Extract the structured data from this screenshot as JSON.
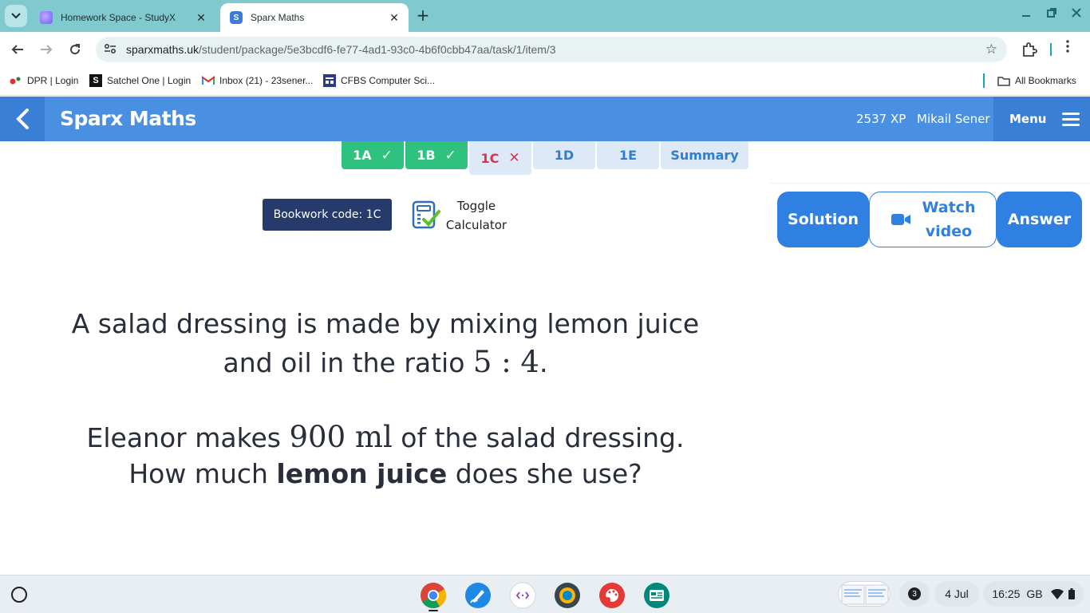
{
  "browser": {
    "tabs": [
      {
        "title": "Homework Space - StudyX",
        "close": "✕"
      },
      {
        "title": "Sparx Maths",
        "favicon_letter": "S",
        "close": "✕"
      }
    ],
    "new_tab": "+",
    "url_host": "sparxmaths.uk",
    "url_path": "/student/package/5e3bcdf6-fe77-4ad1-93c0-4b6f0cbb47aa/task/1/item/3",
    "bookmarks": [
      {
        "label": "DPR | Login"
      },
      {
        "label": "Satchel One | Login",
        "icon_letter": "S"
      },
      {
        "label": "Inbox (21) - 23sener..."
      },
      {
        "label": "CFBS Computer Sci..."
      }
    ],
    "all_bookmarks": "All Bookmarks"
  },
  "header": {
    "brand": "Sparx Maths",
    "xp": "2537 XP",
    "user": "Mikail Sener",
    "menu": "Menu"
  },
  "task_tabs": [
    {
      "label": "1A",
      "status": "correct",
      "mark": "✓"
    },
    {
      "label": "1B",
      "status": "correct",
      "mark": "✓"
    },
    {
      "label": "1C",
      "status": "incorrect",
      "mark": "✕"
    },
    {
      "label": "1D",
      "status": "pending"
    },
    {
      "label": "1E",
      "status": "pending"
    },
    {
      "label": "Summary",
      "status": "pending"
    }
  ],
  "bookwork": {
    "label": "Bookwork code: 1C"
  },
  "calculator": {
    "line1": "Toggle",
    "line2": "Calculator"
  },
  "actions": {
    "solution": "Solution",
    "watch_line1": "Watch",
    "watch_line2": "video",
    "answer": "Answer"
  },
  "question": {
    "line1_text": "A salad dressing is made by mixing lemon juice",
    "line2_text": "and oil in the ratio ",
    "line2_math": "5 : 4",
    "line2_end": ".",
    "line3_text_a": "Eleanor makes ",
    "line3_math": "900 ml",
    "line3_text_b": " of the salad dressing.",
    "line4_text_a": "How much ",
    "line4_bold": "lemon juice",
    "line4_text_b": " does she use?"
  },
  "shelf": {
    "notification_count": "3",
    "date": "4 Jul",
    "time": "16:25",
    "locale": "GB"
  },
  "colors": {
    "sparx_blue": "#4a90e2",
    "correct_green": "#2ec27e",
    "incorrect_red": "#d8344e",
    "bookwork_navy": "#263a6b",
    "tabstrip_teal": "#7fc9cf"
  }
}
